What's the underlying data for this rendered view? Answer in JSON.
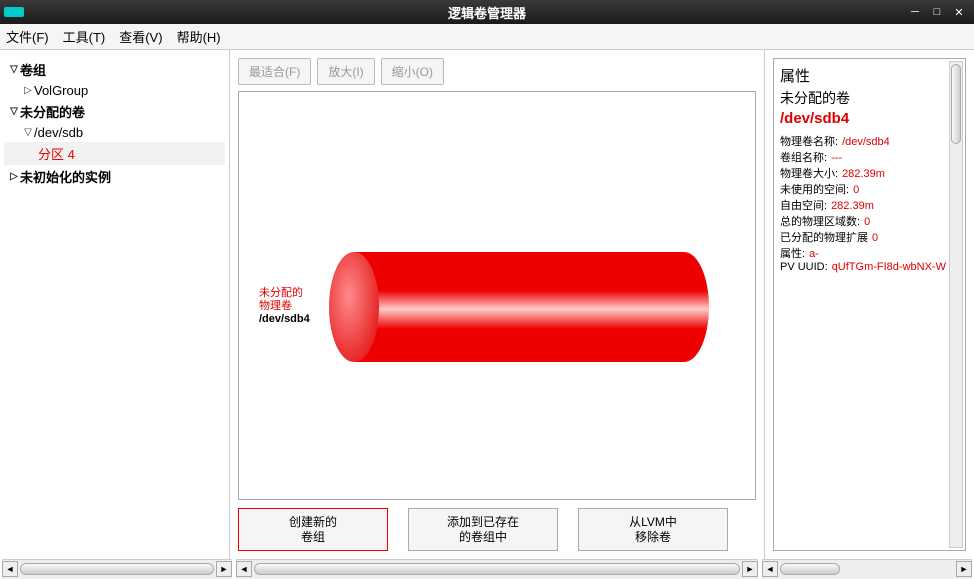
{
  "window": {
    "title": "逻辑卷管理器"
  },
  "menu": {
    "file": "文件(F)",
    "tools": "工具(T)",
    "view": "查看(V)",
    "help": "帮助(H)"
  },
  "tree": {
    "vg": "卷组",
    "volgroup": "VolGroup",
    "unalloc": "未分配的卷",
    "dev": "/dev/sdb",
    "partition": "分区 4",
    "uninit": "未初始化的实例"
  },
  "toolbar": {
    "bestfit": "最适合(F)",
    "zoomin": "放大(I)",
    "zoomout": "缩小(O)"
  },
  "cyl": {
    "l1": "未分配的",
    "l2": "物理卷",
    "l3": "/dev/sdb4"
  },
  "actions": {
    "newvg_l1": "创建新的",
    "newvg_l2": "卷组",
    "addvg_l1": "添加到已存在",
    "addvg_l2": "的卷组中",
    "remove_l1": "从LVM中",
    "remove_l2": "移除卷"
  },
  "right": {
    "title": "属性",
    "sub": "未分配的卷",
    "dev": "/dev/sdb4",
    "props": [
      {
        "label": "物理卷名称:",
        "value": "/dev/sdb4"
      },
      {
        "label": "卷组名称:",
        "value": "---"
      },
      {
        "label": "物理卷大小:",
        "value": "282.39m"
      },
      {
        "label": "未使用的空间:",
        "value": "0"
      },
      {
        "label": "自由空间:",
        "value": "282.39m"
      },
      {
        "label": "总的物理区域数:",
        "value": "0"
      },
      {
        "label": "已分配的物理扩展",
        "value": "0"
      },
      {
        "label": "属性:",
        "value": "a-"
      },
      {
        "label": "PV UUID:",
        "value": "qUfTGm-FI8d-wbNX-W"
      }
    ]
  }
}
